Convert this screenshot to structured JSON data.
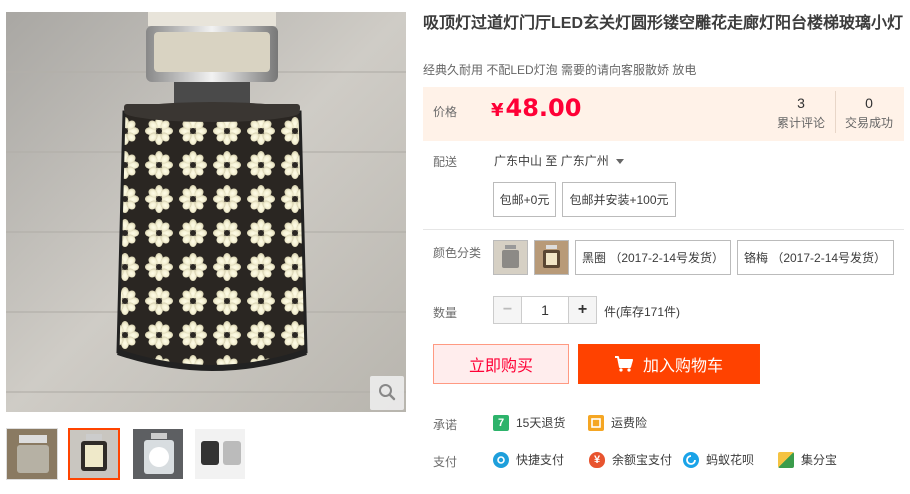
{
  "product": {
    "title": "吸顶灯过道灯门厅LED玄关灯圆形镂空雕花走廊灯阳台楼梯玻璃小灯",
    "subtitle": "经典久耐用 不配LED灯泡 需要的请向客服散娇 放电"
  },
  "gallery": {
    "thumbnails": [
      "lamp-grey-shade",
      "lamp-flower-cage",
      "lamp-frosted-cage",
      "lamp-black-cage"
    ],
    "active_thumbnail": 1,
    "zoom_icon": "search-icon"
  },
  "price": {
    "label": "价格",
    "currency": "¥",
    "amount": "48.00",
    "reviews_count": "3",
    "reviews_label": "累计评论",
    "sales_count": "0",
    "sales_label": "交易成功"
  },
  "shipping": {
    "label": "配送",
    "from": "广东中山",
    "to_word": "至",
    "to": "广东广州",
    "options": [
      "包邮+0元",
      "包邮并安装+100元"
    ]
  },
  "color": {
    "label": "颜色分类",
    "swatches": [
      "grey-fabric-lamp",
      "brown-lamp"
    ],
    "options": [
      "黑圈 （2017-2-14号发货）",
      "铬梅 （2017-2-14号发货）"
    ]
  },
  "quantity": {
    "label": "数量",
    "value": "1",
    "minus": "−",
    "plus": "+",
    "stock_text": "件(库存171件)"
  },
  "actions": {
    "buy_now": "立即购买",
    "add_to_cart": "加入购物车",
    "cart_icon": "cart-icon"
  },
  "promise": {
    "label": "承诺",
    "items": [
      {
        "icon": "return-7day-icon",
        "text": "15天退货",
        "color": "#2db36b"
      },
      {
        "icon": "freight-insurance-icon",
        "text": "运费险",
        "color": "#f5a623"
      }
    ]
  },
  "payment": {
    "label": "支付",
    "items": [
      {
        "icon": "quickpay-icon",
        "text": "快捷支付",
        "color": "#1e9fdb"
      },
      {
        "icon": "yuebao-icon",
        "text": "余额宝支付",
        "color": "#e8542f"
      },
      {
        "icon": "huabei-icon",
        "text": "蚂蚁花呗",
        "color": "#1aa3e8"
      },
      {
        "icon": "jifenbao-icon",
        "text": "集分宝",
        "color": "#3b9c4b"
      }
    ]
  },
  "colors": {
    "accent": "#ff0036",
    "cart_button": "#ff4200",
    "price_bg": "#fff2e8"
  }
}
